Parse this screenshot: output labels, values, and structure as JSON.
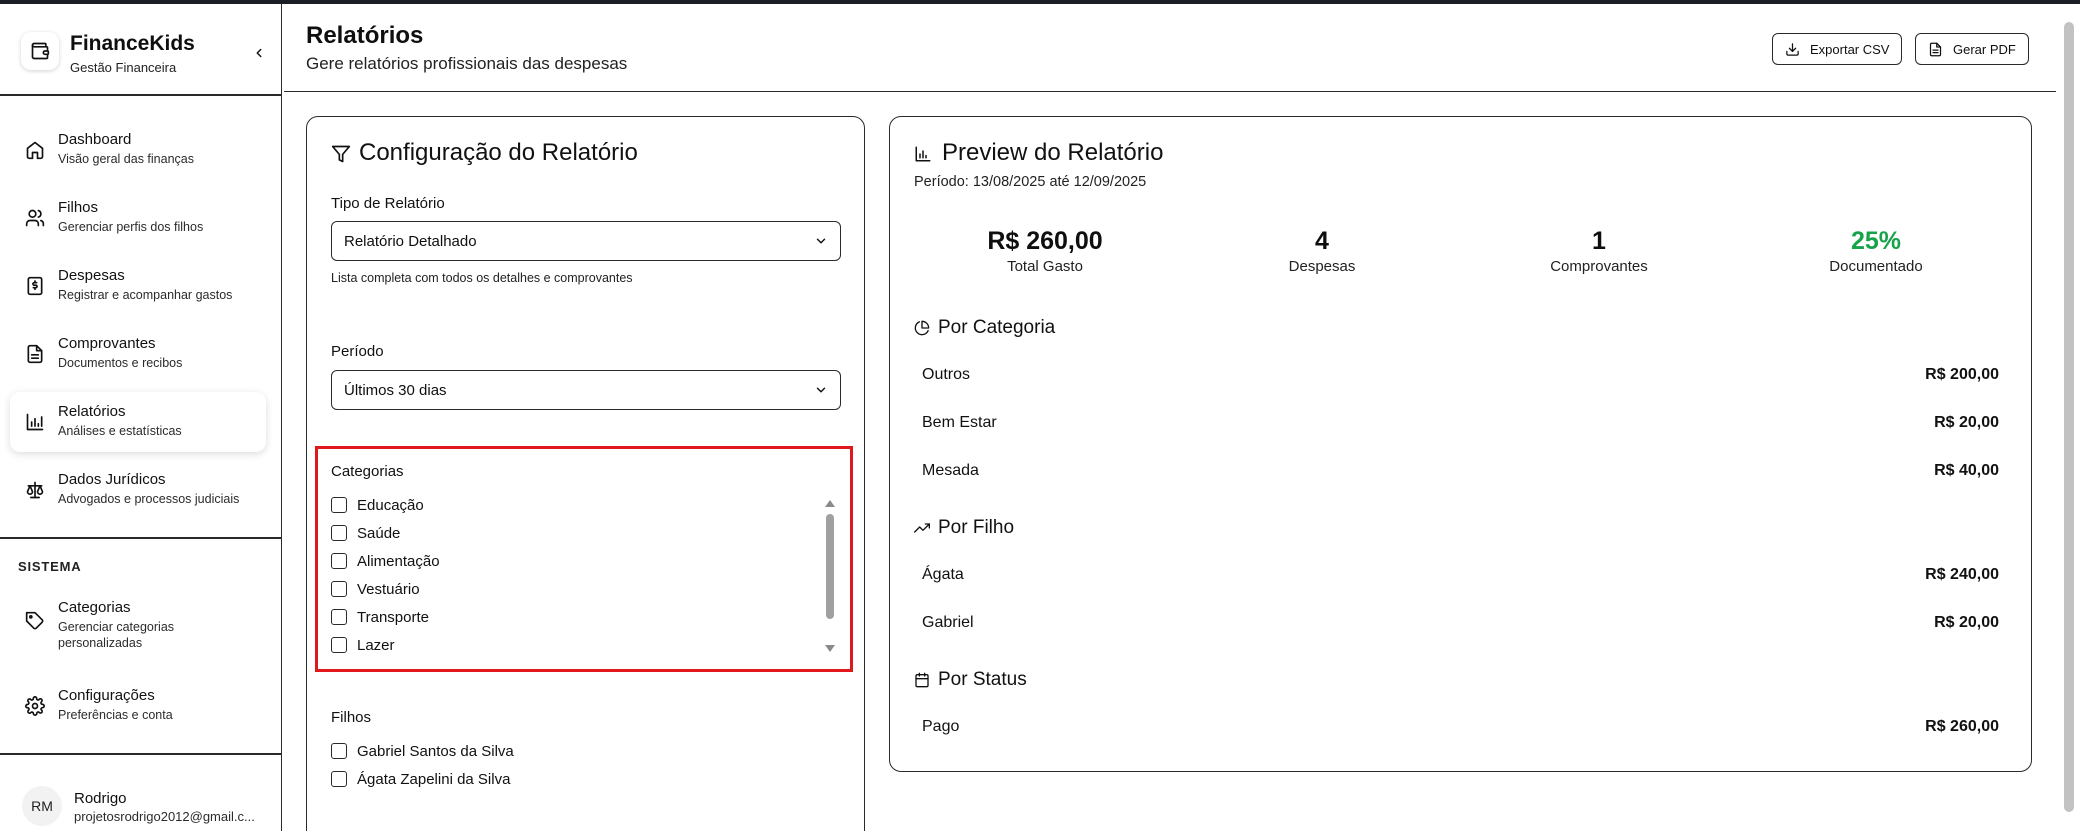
{
  "brand": {
    "title": "FinanceKids",
    "subtitle": "Gestão Financeira"
  },
  "nav": {
    "items": [
      {
        "label": "Dashboard",
        "sub": "Visão geral das finanças",
        "icon": "home-icon"
      },
      {
        "label": "Filhos",
        "sub": "Gerenciar perfis dos filhos",
        "icon": "users-icon"
      },
      {
        "label": "Despesas",
        "sub": "Registrar e acompanhar gastos",
        "icon": "dollar-receipt-icon"
      },
      {
        "label": "Comprovantes",
        "sub": "Documentos e recibos",
        "icon": "document-icon"
      },
      {
        "label": "Relatórios",
        "sub": "Análises e estatísticas",
        "icon": "bar-chart-icon",
        "active": true
      },
      {
        "label": "Dados Jurídicos",
        "sub": "Advogados e processos judiciais",
        "icon": "scale-icon"
      }
    ],
    "system_title": "SISTEMA",
    "system_items": [
      {
        "label": "Categorias",
        "sub": "Gerenciar categorias personalizadas",
        "icon": "tag-icon"
      },
      {
        "label": "Configurações",
        "sub": "Preferências e conta",
        "icon": "gear-icon"
      }
    ]
  },
  "user": {
    "initials": "RM",
    "name": "Rodrigo",
    "email": "projetosrodrigo2012@gmail.c..."
  },
  "header": {
    "title": "Relatórios",
    "subtitle": "Gere relatórios profissionais das despesas",
    "export_csv": "Exportar CSV",
    "generate_pdf": "Gerar PDF"
  },
  "config": {
    "title": "Configuração do Relatório",
    "type_label": "Tipo de Relatório",
    "type_value": "Relatório Detalhado",
    "type_hint": "Lista completa com todos os detalhes e comprovantes",
    "period_label": "Período",
    "period_value": "Últimos 30 dias",
    "categories_label": "Categorias",
    "categories": [
      "Educação",
      "Saúde",
      "Alimentação",
      "Vestuário",
      "Transporte",
      "Lazer"
    ],
    "children_label": "Filhos",
    "children": [
      "Gabriel Santos da Silva",
      "Ágata Zapelini da Silva"
    ]
  },
  "preview": {
    "title": "Preview do Relatório",
    "period": "Período: 13/08/2025 até 12/09/2025",
    "stats": [
      {
        "value": "R$ 260,00",
        "label": "Total Gasto"
      },
      {
        "value": "4",
        "label": "Despesas"
      },
      {
        "value": "1",
        "label": "Comprovantes"
      },
      {
        "value": "25%",
        "label": "Documentado"
      }
    ],
    "accent_green": "#16a34a",
    "by_category_title": "Por Categoria",
    "by_category": [
      {
        "name": "Outros",
        "value": "R$ 200,00"
      },
      {
        "name": "Bem Estar",
        "value": "R$ 20,00"
      },
      {
        "name": "Mesada",
        "value": "R$ 40,00"
      }
    ],
    "by_child_title": "Por Filho",
    "by_child": [
      {
        "name": "Ágata",
        "value": "R$ 240,00"
      },
      {
        "name": "Gabriel",
        "value": "R$ 20,00"
      }
    ],
    "by_status_title": "Por Status",
    "by_status": [
      {
        "name": "Pago",
        "value": "R$ 260,00"
      }
    ]
  },
  "highlight_color": "#e0181b"
}
